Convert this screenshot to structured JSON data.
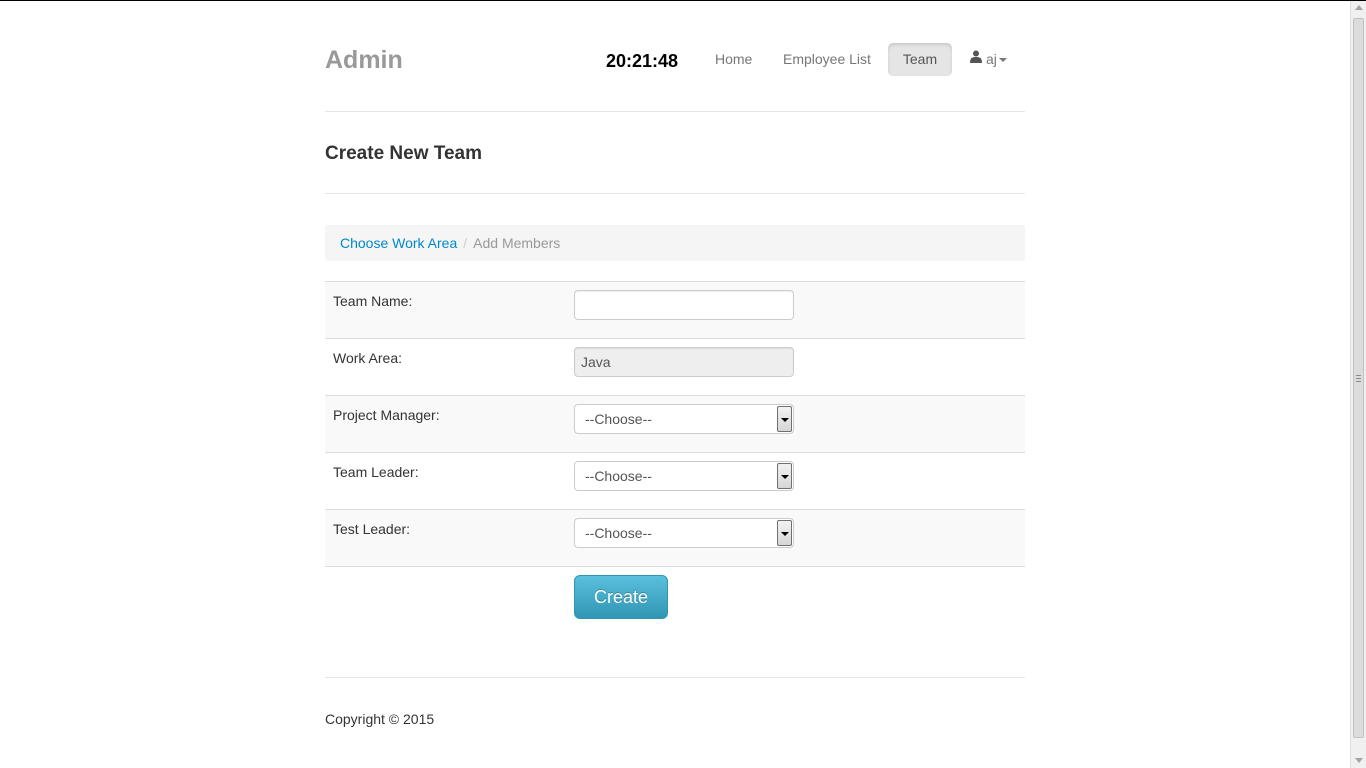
{
  "header": {
    "brand": "Admin",
    "clock": "20:21:48",
    "nav": {
      "home": "Home",
      "employee_list": "Employee List",
      "team": "Team",
      "user": "aj"
    }
  },
  "page": {
    "title": "Create New Team"
  },
  "breadcrumb": {
    "step1": "Choose Work Area",
    "separator": "/",
    "step2": "Add Members"
  },
  "form": {
    "team_name": {
      "label": "Team Name:",
      "value": ""
    },
    "work_area": {
      "label": "Work Area:",
      "value": "Java"
    },
    "project_manager": {
      "label": "Project Manager:",
      "selected": "--Choose--"
    },
    "team_leader": {
      "label": "Team Leader:",
      "selected": "--Choose--"
    },
    "test_leader": {
      "label": "Test Leader:",
      "selected": "--Choose--"
    },
    "submit_label": "Create"
  },
  "footer": {
    "copyright": "Copyright © 2015"
  },
  "colors": {
    "brand": "#999999",
    "link": "#0088cc",
    "button": "#2f96b4",
    "active_nav_bg": "#e5e5e5"
  },
  "icons": {
    "user": "user-icon",
    "dropdown": "caret-down-icon"
  }
}
